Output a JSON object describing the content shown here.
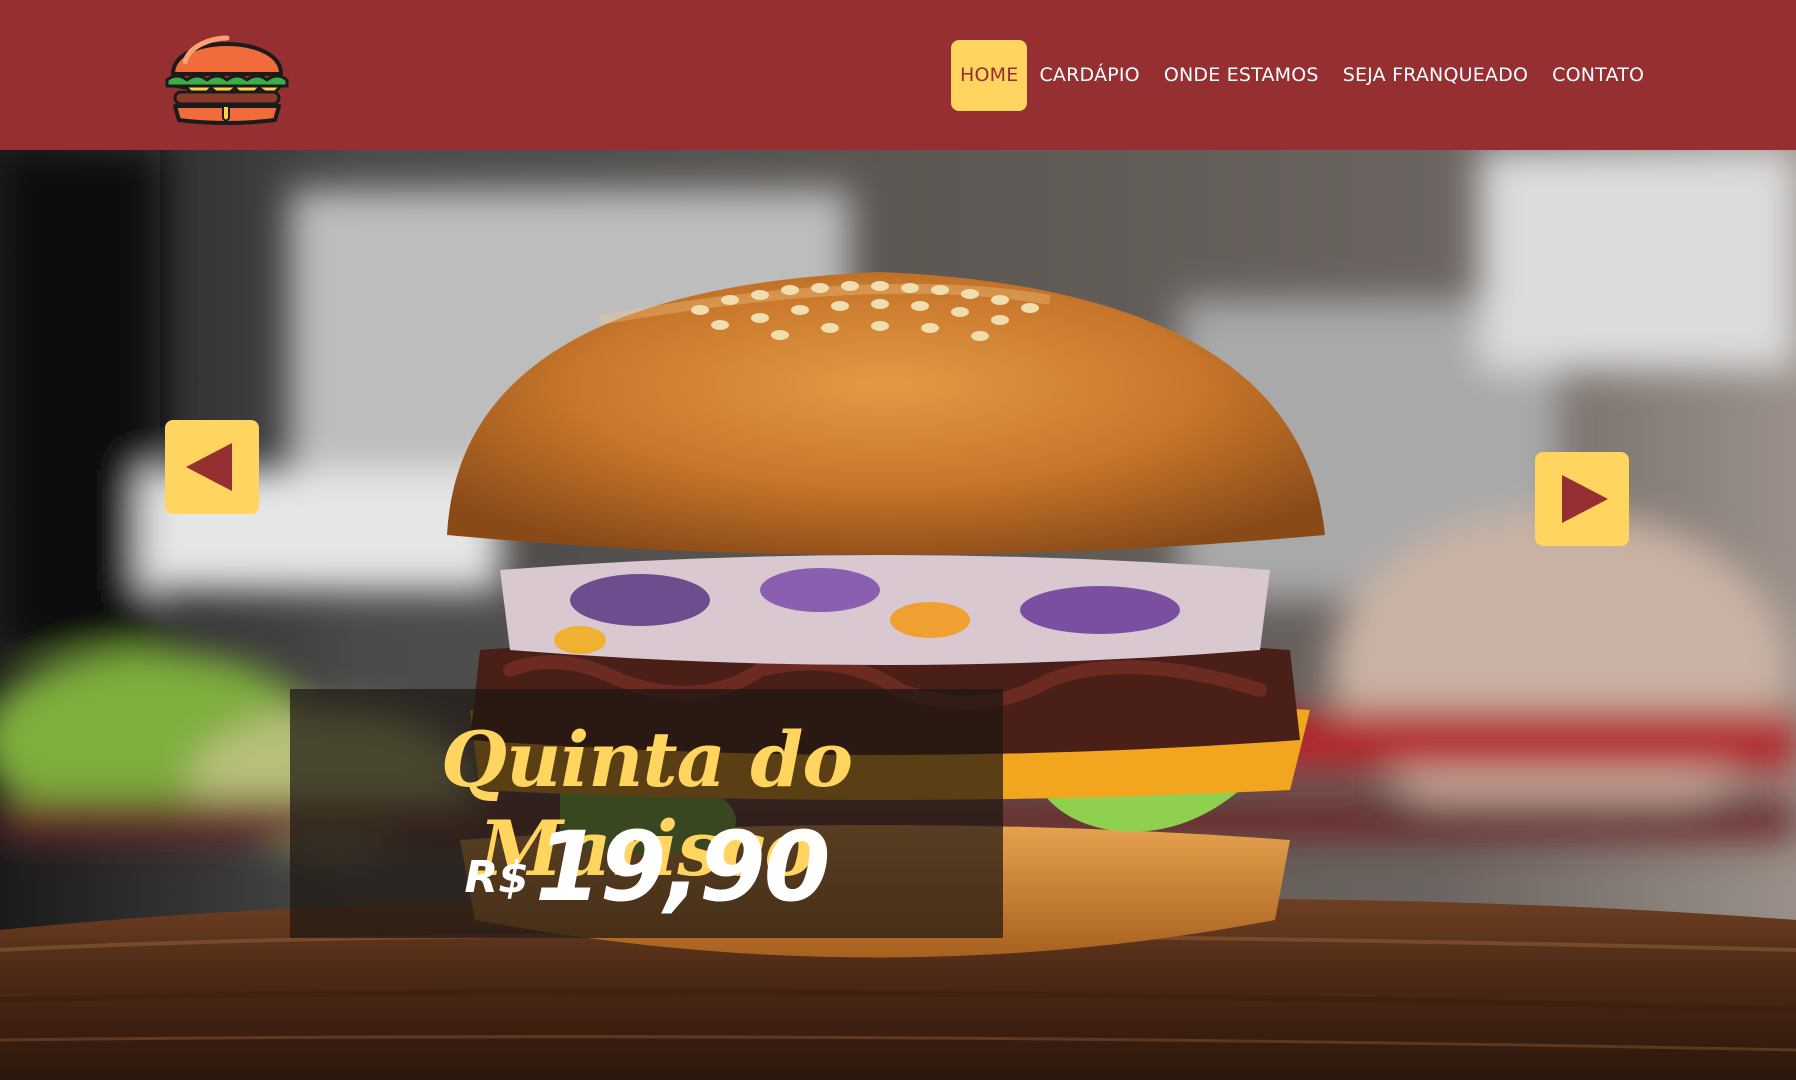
{
  "header": {
    "logo_icon": "burger-logo-icon",
    "nav": [
      {
        "label": "HOME",
        "active": true
      },
      {
        "label": "CARDÁPIO",
        "active": false
      },
      {
        "label": "ONDE ESTAMOS",
        "active": false
      },
      {
        "label": "SEJA FRANQUEADO",
        "active": false
      },
      {
        "label": "CONTATO",
        "active": false
      }
    ]
  },
  "hero": {
    "promo": {
      "title": "Quinta do Marisco",
      "currency": "R$",
      "price": "19,90"
    },
    "controls": {
      "prev_icon": "triangle-left-icon",
      "next_icon": "triangle-right-icon"
    }
  },
  "colors": {
    "brand_red": "#952f32",
    "accent_yellow": "#ffd45f",
    "text_white": "#ffffff"
  }
}
